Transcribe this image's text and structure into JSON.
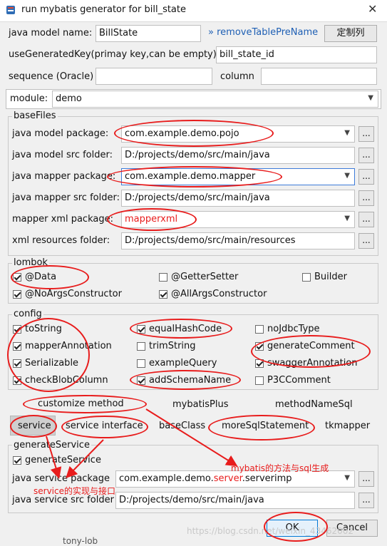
{
  "window": {
    "title": "run mybatis generator for bill_state",
    "close_symbol": "✕"
  },
  "top": {
    "java_model_name_label": "java model name:",
    "java_model_name_value": "BillState",
    "remove_prefix_arrows": "»",
    "remove_prefix_label": "removeTablePreName",
    "custom_column_button": "定制列",
    "use_generated_key_label": "useGeneratedKey(primay key,can be empty):",
    "use_generated_key_value": "bill_state_id",
    "sequence_label": "sequence (Oracle)",
    "sequence_value": "",
    "column_label": "column",
    "column_value": ""
  },
  "module": {
    "label": "module:",
    "value": "demo"
  },
  "basefiles": {
    "title": "baseFiles",
    "java_model_package_label": "java model package:",
    "java_model_package_value": "com.example.demo.pojo",
    "java_model_src_label": "java model src folder:",
    "java_model_src_value": "D:/projects/demo/src/main/java",
    "java_mapper_package_label": "java mapper package:",
    "java_mapper_package_value": "com.example.demo.mapper",
    "java_mapper_src_label": "java mapper src folder:",
    "java_mapper_src_value": "D:/projects/demo/src/main/java",
    "mapper_xml_package_label": "mapper xml package:",
    "mapper_xml_package_value": "mapperxml",
    "xml_resources_label": "xml resources folder:",
    "xml_resources_value": "D:/projects/demo/src/main/resources",
    "browse": "..."
  },
  "lombok": {
    "title": "lombok",
    "items": [
      {
        "label": "@Data",
        "checked": true
      },
      {
        "label": "@GetterSetter",
        "checked": false
      },
      {
        "label": "Builder",
        "checked": false
      },
      {
        "label": "@NoArgsConstructor",
        "checked": true
      },
      {
        "label": "@AllArgsConstructor",
        "checked": true
      }
    ]
  },
  "config": {
    "title": "config",
    "items": [
      {
        "label": "toString",
        "checked": true
      },
      {
        "label": "equalHashCode",
        "checked": true
      },
      {
        "label": "noJdbcType",
        "checked": false
      },
      {
        "label": "mapperAnnotation",
        "checked": true
      },
      {
        "label": "trimString",
        "checked": false
      },
      {
        "label": "generateComment",
        "checked": true
      },
      {
        "label": "Serializable",
        "checked": true
      },
      {
        "label": "exampleQuery",
        "checked": false
      },
      {
        "label": "swaggerAnnotation",
        "checked": true
      },
      {
        "label": "checkBlobColumn",
        "checked": true
      },
      {
        "label": "addSchemaName",
        "checked": true
      },
      {
        "label": "P3CComment",
        "checked": false
      }
    ]
  },
  "tabs": {
    "row1": [
      "customize method",
      "mybatisPlus",
      "methodNameSql"
    ],
    "row2": [
      "service",
      "service interface",
      "baseClass",
      "moreSqlStatement",
      "tkmapper"
    ]
  },
  "service": {
    "title": "generateService",
    "generate_label": "generateService",
    "generate_checked": true,
    "package_label": "java service package",
    "package_value_prefix": "com.example.demo.",
    "package_value_highlight": "server",
    "package_value_suffix": ".serverimp",
    "src_label": "java service src folder",
    "src_value": "D:/projects/demo/src/main/java"
  },
  "annotations": {
    "mybatis_note": "mybatis的方法与sql生成",
    "service_note": "service的实现与接口"
  },
  "buttons": {
    "ok": "OK",
    "cancel": "Cancel"
  },
  "background_snippet": "tony-lob",
  "watermark": "https://blog.csdn.net/weixin_43462002",
  "colors": {
    "annotation_red": "#e81c1c",
    "link_blue": "#1e5fb4"
  }
}
